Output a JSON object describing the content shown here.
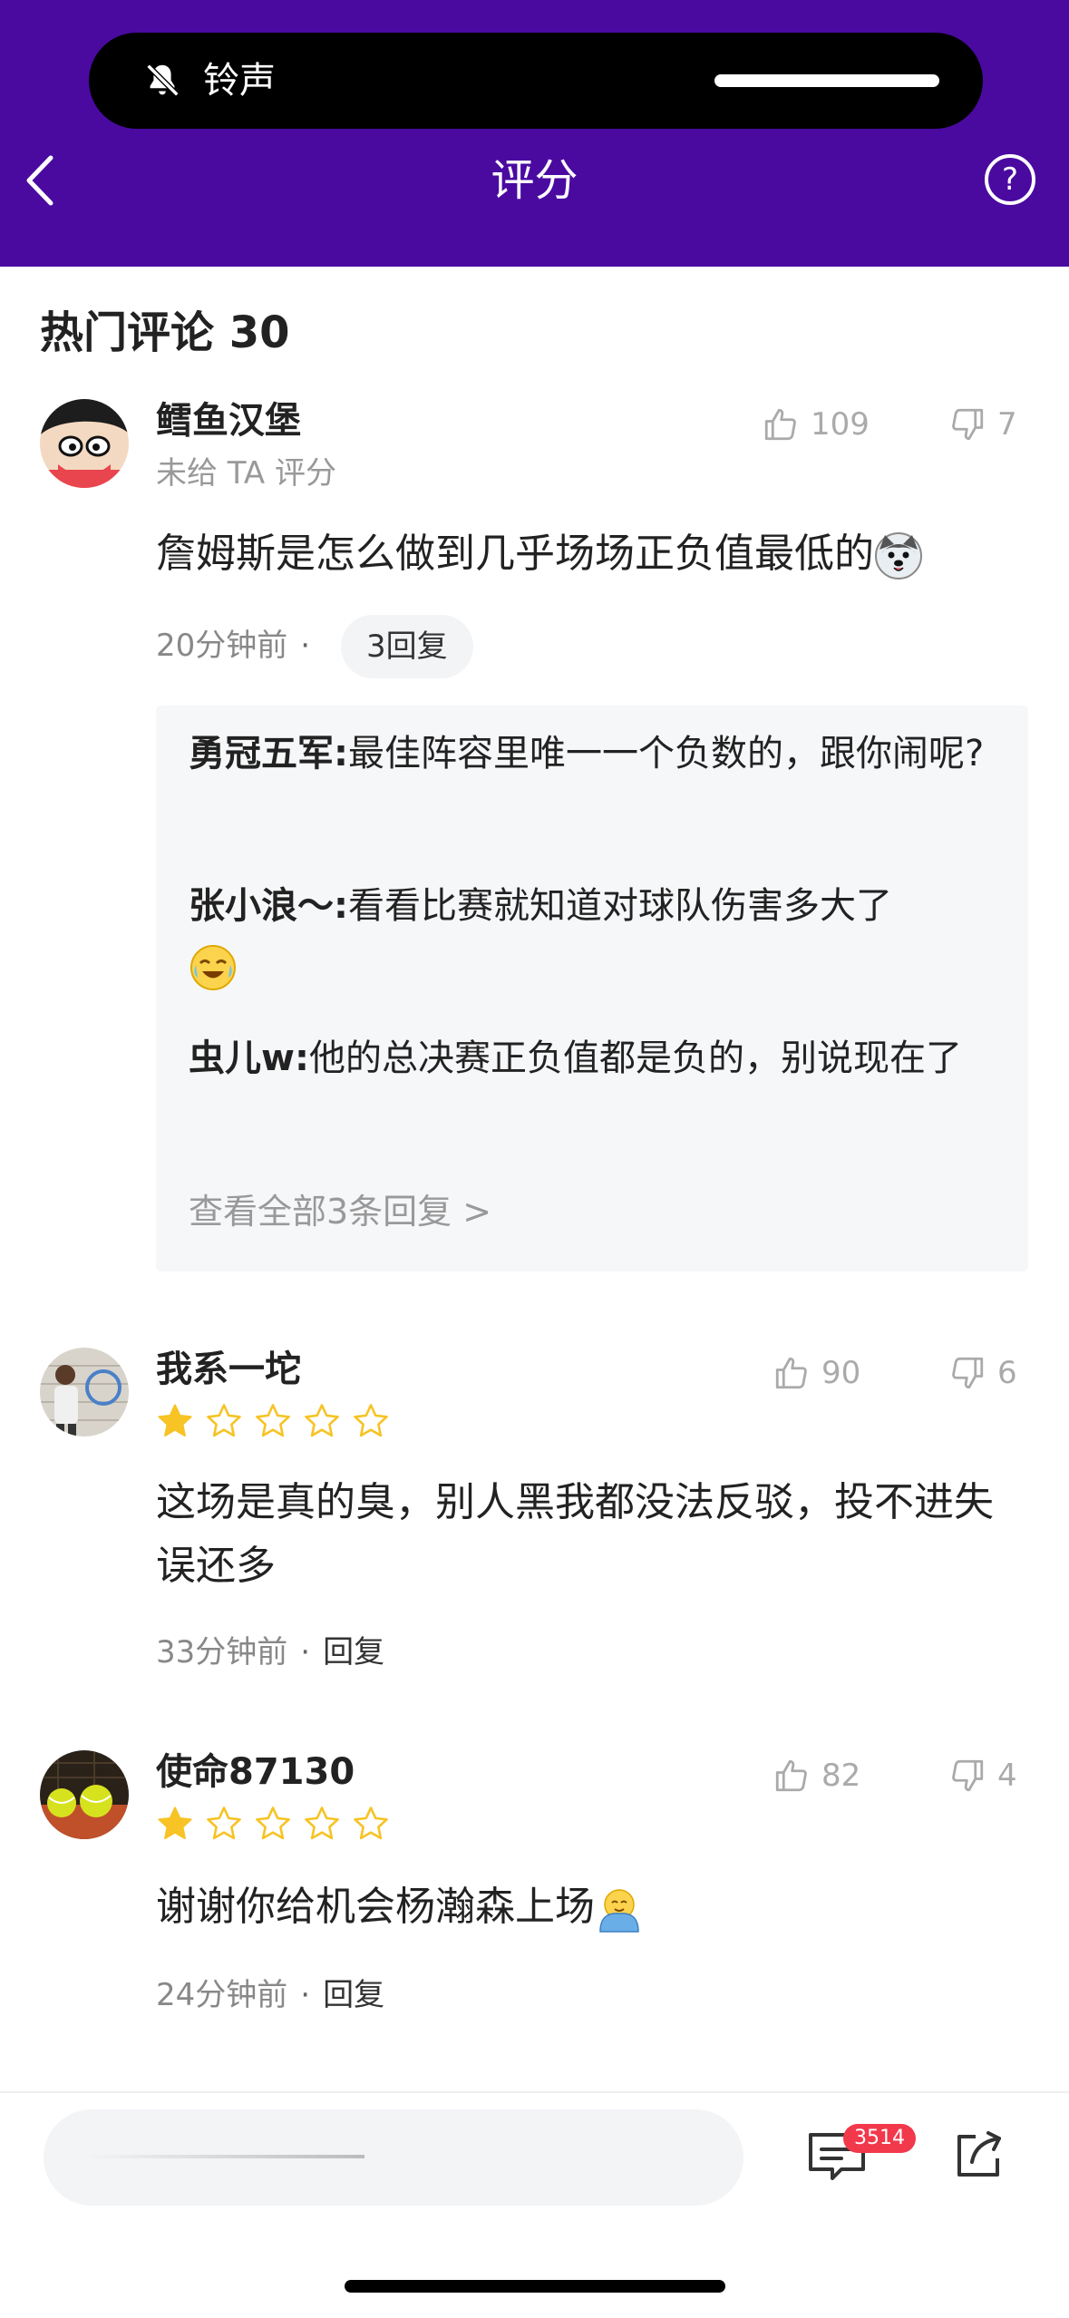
{
  "status_island": {
    "label": "铃声",
    "icon": "bell-slash-icon"
  },
  "nav": {
    "title": "评分",
    "back_icon": "chevron-left-icon",
    "help_icon": "question-circle-icon",
    "help_glyph": "?"
  },
  "section": {
    "title": "热门评论 30"
  },
  "colors": {
    "header_bg": "#4a0aa0",
    "star_filled": "#f7c325",
    "badge": "#f2384b"
  },
  "comments": [
    {
      "username": "鳕鱼汉堡",
      "subtitle": "未给 TA 评分",
      "likes": "109",
      "dislikes": "7",
      "text": "詹姆斯是怎么做到几乎场场正负值最低的",
      "time": "20分钟前",
      "separator": "·",
      "reply_label": "3回复",
      "replies": [
        {
          "user": "勇冠五军:",
          "text": "最佳阵容里唯一一个负数的，跟你闹呢?"
        },
        {
          "user": "张小浪～:",
          "text": "看看比赛就知道对球队伤害多大了"
        },
        {
          "user": "虫儿w:",
          "text": "他的总决赛正负值都是负的，别说现在了"
        }
      ],
      "view_all": "查看全部3条回复 >"
    },
    {
      "username": "我系一坨",
      "rating": 1,
      "likes": "90",
      "dislikes": "6",
      "text": "这场是真的臭，别人黑我都没法反驳，投不进失误还多",
      "time": "33分钟前",
      "separator": "·",
      "reply_label": "回复"
    },
    {
      "username": "使命87130",
      "rating": 1,
      "likes": "82",
      "dislikes": "4",
      "text": "谢谢你给机会杨瀚森上场",
      "time": "24分钟前",
      "separator": "·",
      "reply_label": "回复"
    }
  ],
  "bottom_bar": {
    "comment_count": "3514",
    "comment_icon": "comment-icon",
    "share_icon": "share-icon"
  }
}
